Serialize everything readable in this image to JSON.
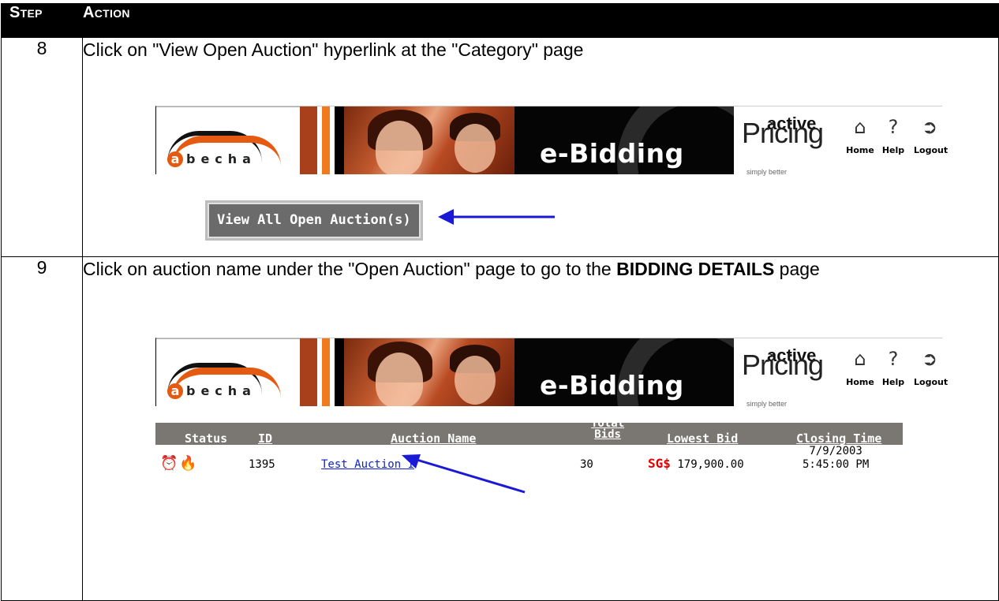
{
  "table": {
    "header": {
      "step": "Step",
      "action": "Action"
    },
    "rows": [
      {
        "step": "8",
        "action": "Click on \"View Open Auction\" hyperlink at the \"Category\" page"
      },
      {
        "step": "9",
        "action_pre": "Click on auction name under the \"Open Auction\" page to go to the ",
        "action_bold": "BIDDING DETAILS",
        "action_post": " page"
      }
    ]
  },
  "banner": {
    "logo_text": "becha",
    "logo_initial": "a",
    "title": "e-Bidding",
    "brand_active": "active",
    "brand_pricing": "Pricing",
    "brand_tagline": "simply better",
    "nav": [
      {
        "label": "Home",
        "icon": "home-icon"
      },
      {
        "label": "Help",
        "icon": "help-icon"
      },
      {
        "label": "Logout",
        "icon": "logout-icon"
      }
    ]
  },
  "view_button": "View All Open Auction(s)",
  "auction_table": {
    "columns": [
      "Status",
      "ID",
      "Auction Name",
      "Total Bids",
      "Lowest Bid",
      "Closing Time"
    ],
    "total_bids_top": "Total",
    "total_bids_bottom": "Bids",
    "row": {
      "id": "1395",
      "name": "Test Auction I",
      "total_bids": "30",
      "currency": "SG$",
      "lowest_bid": "179,900.00",
      "closing_date": "7/9/2003",
      "closing_time": "5:45:00 PM"
    }
  },
  "colors": {
    "arrow": "#1a1ad6",
    "header_bg": "#000000",
    "accent": "#e35a10"
  }
}
